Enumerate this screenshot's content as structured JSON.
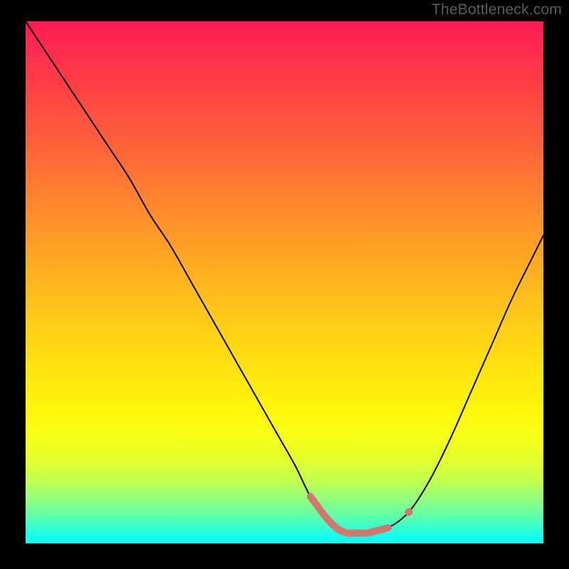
{
  "watermark": "TheBottleneck.com",
  "colors": {
    "background": "#000000",
    "curve": "#000000",
    "highlight": "#d5766e"
  },
  "chart_data": {
    "type": "line",
    "title": "",
    "xlabel": "",
    "ylabel": "",
    "xlim": [
      0,
      100
    ],
    "ylim": [
      0,
      100
    ],
    "grid": false,
    "series": [
      {
        "name": "bottleneck-curve",
        "x": [
          0,
          4,
          8,
          12,
          16,
          20,
          24,
          28,
          32,
          36,
          40,
          44,
          48,
          52,
          55,
          58,
          60,
          62,
          64,
          66,
          70,
          74,
          78,
          82,
          86,
          90,
          94,
          98,
          100
        ],
        "y": [
          100,
          94,
          88,
          82,
          76,
          70,
          63,
          57,
          50,
          43,
          36,
          29,
          22,
          15,
          9,
          5,
          3,
          2,
          2,
          2,
          3,
          6,
          12,
          20,
          29,
          38,
          47,
          55,
          59
        ]
      }
    ],
    "highlight_range": {
      "description": "thick salmon overlay on curve near minimum + detached dot",
      "x_start": 55,
      "x_end": 70,
      "dot_x": 74
    },
    "gradient_stops": [
      {
        "pos": 0.0,
        "color": "#ff1a54"
      },
      {
        "pos": 0.24,
        "color": "#ff633a"
      },
      {
        "pos": 0.55,
        "color": "#ffc51a"
      },
      {
        "pos": 0.75,
        "color": "#fff80a"
      },
      {
        "pos": 0.88,
        "color": "#c3ff4e"
      },
      {
        "pos": 1.0,
        "color": "#06fff7"
      }
    ]
  }
}
